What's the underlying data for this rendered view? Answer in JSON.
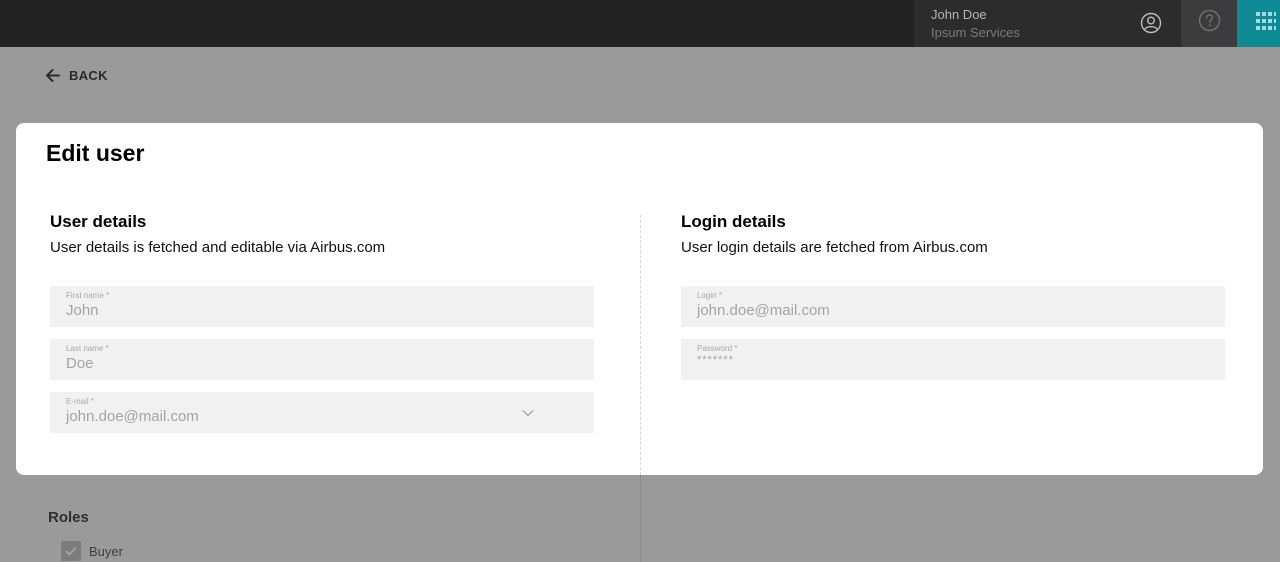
{
  "header": {
    "user_name": "John Doe",
    "user_company": "Ipsum Services",
    "account_icon": "account-icon",
    "help_icon": "help-icon",
    "apps_icon": "apps-grid-icon",
    "colors": {
      "topbar": "#222324",
      "apps_accent": "#0d8a93"
    }
  },
  "nav": {
    "back_label": "BACK",
    "back_icon": "arrow-left-icon"
  },
  "modal": {
    "title": "Edit user",
    "user_details": {
      "title": "User details",
      "description": "User details is fetched and editable via Airbus.com",
      "fields": [
        {
          "label": "First name *",
          "value": "John"
        },
        {
          "label": "Last name *",
          "value": "Doe"
        },
        {
          "label": "E-mail *",
          "value": "john.doe@mail.com"
        }
      ]
    },
    "login_details": {
      "title": "Login details",
      "description": "User login details are fetched from Airbus.com",
      "fields": [
        {
          "label": "Login *",
          "value": "john.doe@mail.com"
        },
        {
          "label": "Password *",
          "value": "*******"
        }
      ]
    }
  },
  "background": {
    "roles_title": "Roles",
    "roles": [
      {
        "label": "Buyer",
        "checked": true
      }
    ]
  }
}
